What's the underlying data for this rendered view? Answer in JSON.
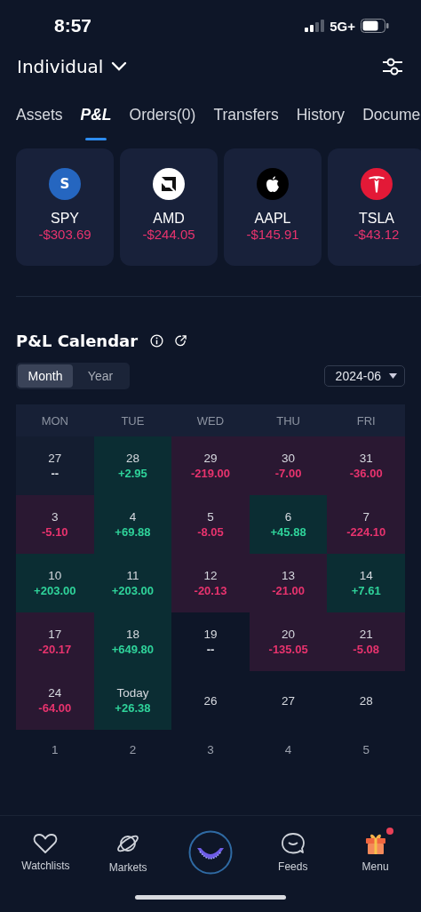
{
  "status_bar": {
    "time": "8:57",
    "network": "5G+"
  },
  "header": {
    "account": "Individual"
  },
  "tabs": [
    {
      "label": "Assets",
      "selected": false
    },
    {
      "label": "P&L",
      "selected": true
    },
    {
      "label": "Orders(0)",
      "selected": false
    },
    {
      "label": "Transfers",
      "selected": false
    },
    {
      "label": "History",
      "selected": false
    },
    {
      "label": "Docume",
      "selected": false
    }
  ],
  "holdings": [
    {
      "symbol": "SPY",
      "pnl": "-$303.69",
      "letter": "S"
    },
    {
      "symbol": "AMD",
      "pnl": "-$244.05"
    },
    {
      "symbol": "AAPL",
      "pnl": "-$145.91"
    },
    {
      "symbol": "TSLA",
      "pnl": "-$43.12"
    }
  ],
  "calendar": {
    "title": "P&L Calendar",
    "periods": [
      {
        "label": "Month",
        "selected": true
      },
      {
        "label": "Year",
        "selected": false
      }
    ],
    "month": "2024-06",
    "weekdays": [
      "MON",
      "TUE",
      "WED",
      "THU",
      "FRI"
    ],
    "weeks": [
      [
        {
          "day": "27",
          "value": "--",
          "kind": "flat"
        },
        {
          "day": "28",
          "value": "+2.95",
          "kind": "gain"
        },
        {
          "day": "29",
          "value": "-219.00",
          "kind": "loss"
        },
        {
          "day": "30",
          "value": "-7.00",
          "kind": "loss"
        },
        {
          "day": "31",
          "value": "-36.00",
          "kind": "loss"
        }
      ],
      [
        {
          "day": "3",
          "value": "-5.10",
          "kind": "loss"
        },
        {
          "day": "4",
          "value": "+69.88",
          "kind": "gain"
        },
        {
          "day": "5",
          "value": "-8.05",
          "kind": "loss"
        },
        {
          "day": "6",
          "value": "+45.88",
          "kind": "gain"
        },
        {
          "day": "7",
          "value": "-224.10",
          "kind": "loss"
        }
      ],
      [
        {
          "day": "10",
          "value": "+203.00",
          "kind": "gain"
        },
        {
          "day": "11",
          "value": "+203.00",
          "kind": "gain"
        },
        {
          "day": "12",
          "value": "-20.13",
          "kind": "loss"
        },
        {
          "day": "13",
          "value": "-21.00",
          "kind": "loss"
        },
        {
          "day": "14",
          "value": "+7.61",
          "kind": "gain"
        }
      ],
      [
        {
          "day": "17",
          "value": "-20.17",
          "kind": "loss"
        },
        {
          "day": "18",
          "value": "+649.80",
          "kind": "gain"
        },
        {
          "day": "19",
          "value": "--",
          "kind": "none"
        },
        {
          "day": "20",
          "value": "-135.05",
          "kind": "loss"
        },
        {
          "day": "21",
          "value": "-5.08",
          "kind": "loss"
        }
      ],
      [
        {
          "day": "24",
          "value": "-64.00",
          "kind": "loss"
        },
        {
          "day": "Today",
          "value": "+26.38",
          "kind": "gain"
        },
        {
          "day": "26",
          "kind": "none"
        },
        {
          "day": "27",
          "kind": "none"
        },
        {
          "day": "28",
          "kind": "none"
        }
      ]
    ],
    "next_month_days": [
      "1",
      "2",
      "3",
      "4",
      "5"
    ]
  },
  "bottom_nav": [
    {
      "label": "Watchlists",
      "badge": false
    },
    {
      "label": "Markets",
      "badge": false
    },
    {
      "badge": false
    },
    {
      "label": "Feeds",
      "badge": false
    },
    {
      "label": "Menu",
      "badge": true
    }
  ]
}
